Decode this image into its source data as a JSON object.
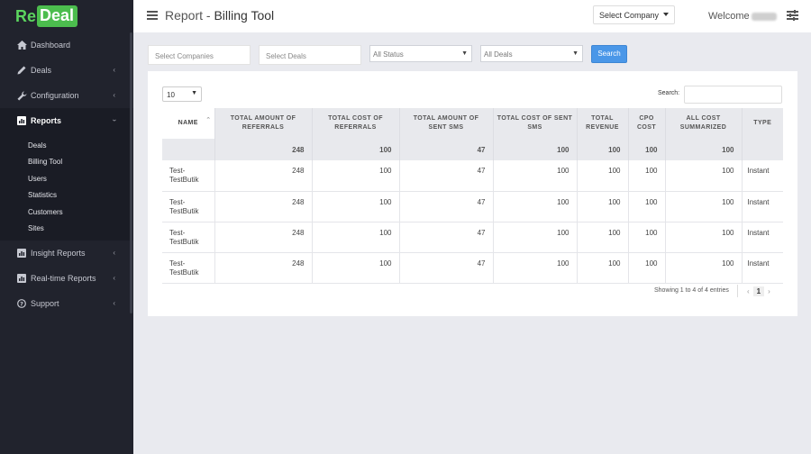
{
  "logo": {
    "re": "Re",
    "deal": "Deal"
  },
  "sidebar": {
    "items": [
      {
        "label": "Dashboard",
        "icon": "home-icon"
      },
      {
        "label": "Deals",
        "icon": "pencil-icon"
      },
      {
        "label": "Configuration",
        "icon": "wrench-icon"
      },
      {
        "label": "Reports",
        "icon": "chart-icon"
      },
      {
        "label": "Insight Reports",
        "icon": "chart-icon"
      },
      {
        "label": "Real-time Reports",
        "icon": "chart-icon"
      },
      {
        "label": "Support",
        "icon": "question-icon"
      }
    ],
    "reports_sub": [
      "Deals",
      "Billing Tool",
      "Users",
      "Statistics",
      "Customers",
      "Sites"
    ]
  },
  "header": {
    "title_prefix": "Report - ",
    "title_main": "Billing Tool",
    "company_select": "Select Company",
    "welcome": "Welcome"
  },
  "filters": {
    "companies_placeholder": "Select Companies",
    "deals_placeholder": "Select Deals",
    "status": "All Status",
    "deals_select": "All Deals",
    "search_button": "Search"
  },
  "table": {
    "page_length": "10",
    "search_label": "Search:",
    "headers": [
      "Name",
      "Total amount of referrals",
      "Total cost of referrals",
      "Total amount of sent SMS",
      "Total cost of sent SMS",
      "Total revenue",
      "CPO cost",
      "All cost summarized",
      "Type"
    ],
    "summary": [
      "",
      "248",
      "100",
      "47",
      "100",
      "100",
      "100",
      "100",
      ""
    ],
    "rows": [
      [
        "Test-TestButik",
        "248",
        "100",
        "47",
        "100",
        "100",
        "100",
        "100",
        "Instant"
      ],
      [
        "Test-TestButik",
        "248",
        "100",
        "47",
        "100",
        "100",
        "100",
        "100",
        "Instant"
      ],
      [
        "Test-TestButik",
        "248",
        "100",
        "47",
        "100",
        "100",
        "100",
        "100",
        "Instant"
      ],
      [
        "Test-TestButik",
        "248",
        "100",
        "47",
        "100",
        "100",
        "100",
        "100",
        "Instant"
      ]
    ],
    "info": "Showing 1 to 4 of 4 entries",
    "current_page": "1"
  },
  "colors": {
    "sidebar_bg": "#21232d",
    "brand_green": "#4cbd4e",
    "search_button": "#4a97e8"
  }
}
